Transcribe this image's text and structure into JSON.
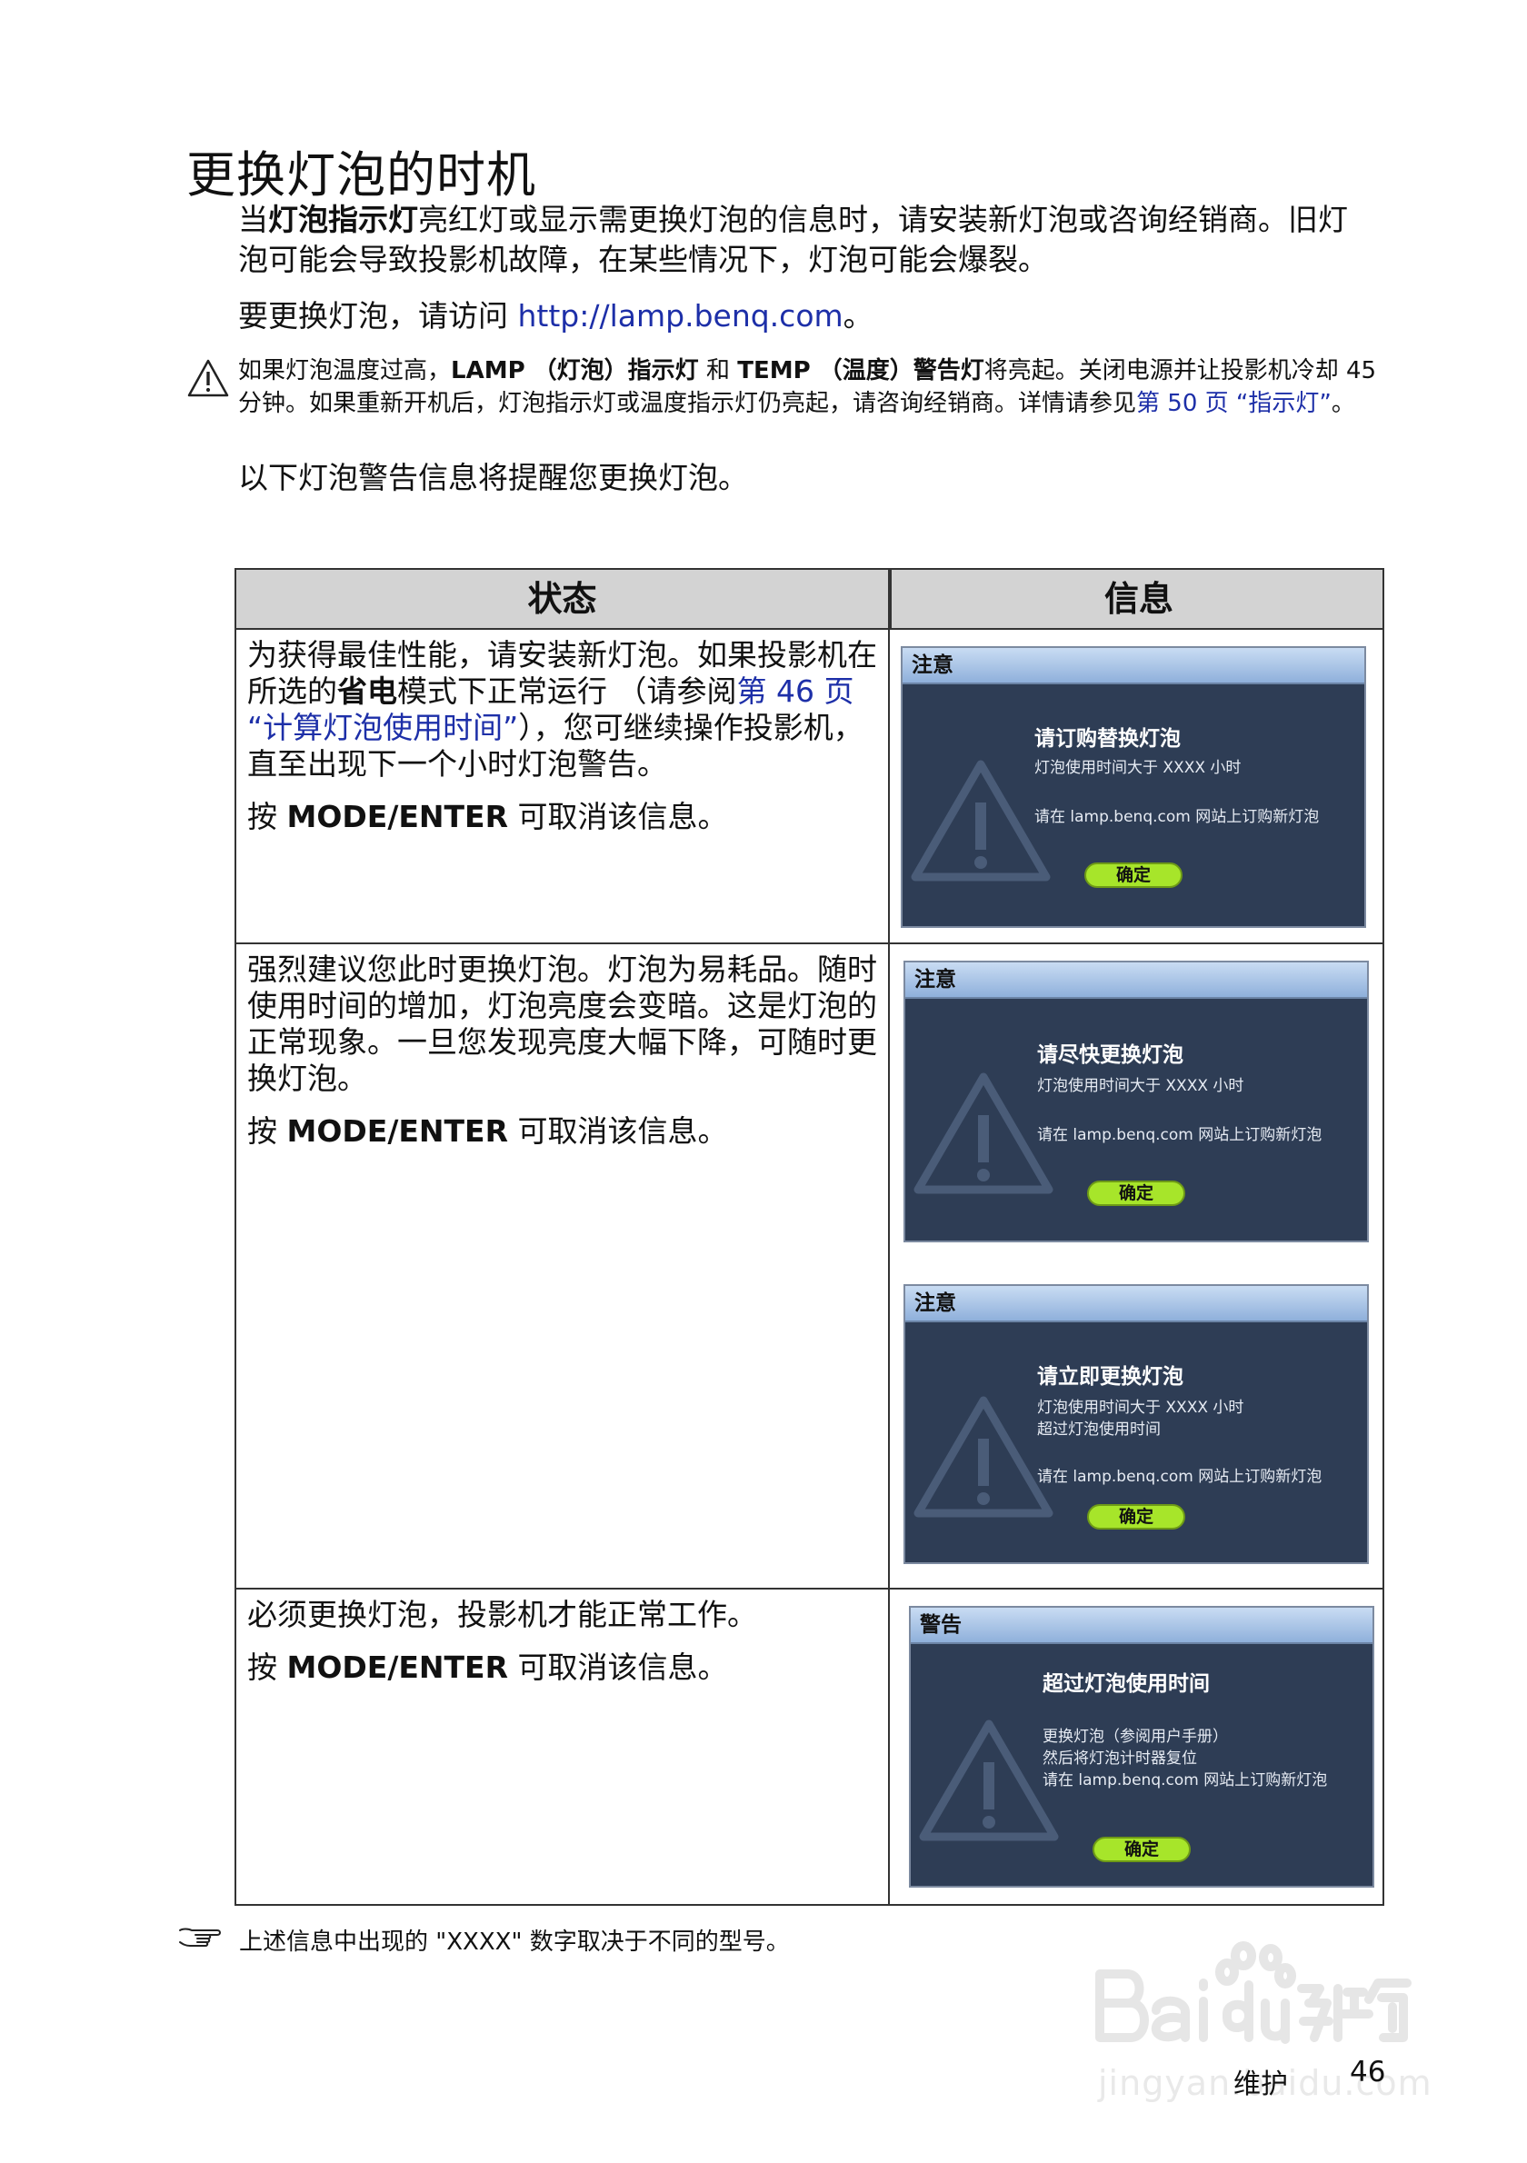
{
  "page": {
    "title": "更换灯泡的时机",
    "intro_pre": "当",
    "intro_bold": "灯泡指示灯",
    "intro_post": "亮红灯或显示需更换灯泡的信息时，请安装新灯泡或咨询经销商。旧灯泡可能会导致投影机故障，在某些情况下，灯泡可能会爆裂。",
    "visit_pre": "要更换灯泡，请访问 ",
    "visit_link": "http://lamp.benq.com",
    "visit_post": "。",
    "warning_1": "如果灯泡温度过高，",
    "warning_lamp": "LAMP （灯泡）指示灯",
    "warning_2": " 和 ",
    "warning_temp": "TEMP （温度）警告灯",
    "warning_3": "将亮起。关闭电源并让投影机冷却 45 分钟。如果重新开机后，灯泡指示灯或温度指示灯仍亮起，请咨询经销商。详情请参见",
    "warning_link": "第 50 页 “指示灯”",
    "warning_4": "。",
    "lead": "以下灯泡警告信息将提醒您更换灯泡。"
  },
  "table": {
    "header_state": "状态",
    "header_info": "信息",
    "rows": [
      {
        "text_pre": "为获得最佳性能，请安装新灯泡。如果投影机在所选的",
        "text_bold": "省电",
        "text_mid": "模式下正常运行 （请参阅",
        "text_link": "第 46 页 “计算灯泡使用时间”",
        "text_post": "），您可继续操作投影机，直至出现下一个小时灯泡警告。",
        "press_pre": "按 ",
        "press_key": "MODE/ENTER",
        "press_post": " 可取消该信息。"
      },
      {
        "text": "强烈建议您此时更换灯泡。灯泡为易耗品。随时使用时间的增加，灯泡亮度会变暗。这是灯泡的正常现象。一旦您发现亮度大幅下降，可随时更换灯泡。",
        "press_pre": "按 ",
        "press_key": "MODE/ENTER",
        "press_post": " 可取消该信息。"
      },
      {
        "text": "必须更换灯泡，投影机才能正常工作。",
        "press_pre": "按 ",
        "press_key": "MODE/ENTER",
        "press_post": " 可取消该信息。"
      }
    ]
  },
  "osd": [
    {
      "header": "注意",
      "title": "请订购替换灯泡",
      "lines": [
        "灯泡使用时间大于 XXXX 小时",
        "请在 lamp.benq.com 网站上订购新灯泡"
      ],
      "button": "确定"
    },
    {
      "header": "注意",
      "title": "请尽快更换灯泡",
      "lines": [
        "灯泡使用时间大于 XXXX 小时",
        "请在 lamp.benq.com 网站上订购新灯泡"
      ],
      "button": "确定"
    },
    {
      "header": "注意",
      "title": "请立即更换灯泡",
      "lines": [
        "灯泡使用时间大于 XXXX 小时",
        "超过灯泡使用时间",
        "请在 lamp.benq.com 网站上订购新灯泡"
      ],
      "button": "确定"
    },
    {
      "header": "警告",
      "title": "超过灯泡使用时间",
      "lines": [
        "更换灯泡（参阅用户手册）",
        "然后将灯泡计时器复位",
        "请在 lamp.benq.com 网站上订购新灯泡"
      ],
      "button": "确定"
    }
  ],
  "note": "上述信息中出现的 \"XXXX\" 数字取决于不同的型号。",
  "footer": {
    "section": "维护",
    "page_number": "46"
  },
  "watermark": {
    "url": "jingyan.baidu.com"
  }
}
